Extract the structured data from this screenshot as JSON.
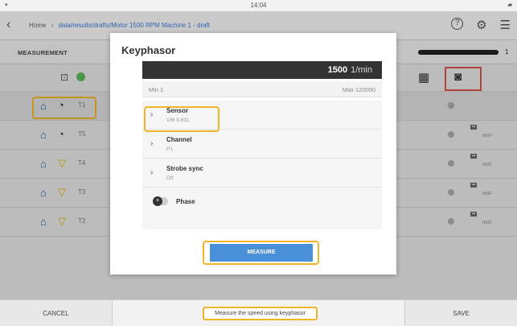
{
  "status_bar": {
    "time": "14:04",
    "signal": "▾",
    "battery": "▰"
  },
  "top_bar": {
    "back": "‹",
    "breadcrumb_home": "Home",
    "breadcrumb_sep": "›",
    "breadcrumb_path": "data/results/drafts/Motor 1500 RPM Machine 1 - draft",
    "help_icon": "?",
    "settings_icon": "⚙",
    "menu_icon": "☰"
  },
  "measurement": {
    "title": "MEASUREMENT",
    "progress_value": "1",
    "progress_fraction": 1.0,
    "rows": [
      {
        "label": "T1",
        "sensor_icon": "probe"
      },
      {
        "label": "T5",
        "sensor_icon": "probe"
      },
      {
        "label": "T4",
        "sensor_icon": "triangle"
      },
      {
        "label": "T3",
        "sensor_icon": "triangle"
      },
      {
        "label": "T2",
        "sensor_icon": "triangle"
      }
    ],
    "row_unit": "m/s²",
    "row_value": "-"
  },
  "modal": {
    "title": "Keyphasor",
    "value": "1500",
    "unit": "1/min",
    "min": "Min 1",
    "max": "Max 120000",
    "items": [
      {
        "name": "Sensor",
        "sub": "VIB 6.631"
      },
      {
        "name": "Channel",
        "sub": "P1"
      },
      {
        "name": "Strobe sync",
        "sub": "Off"
      }
    ],
    "phase_label": "Phase",
    "measure_button": "MEASURE"
  },
  "bottom_bar": {
    "cancel": "CANCEL",
    "hint": "Measure the speed using keyphasor",
    "save": "SAVE"
  }
}
